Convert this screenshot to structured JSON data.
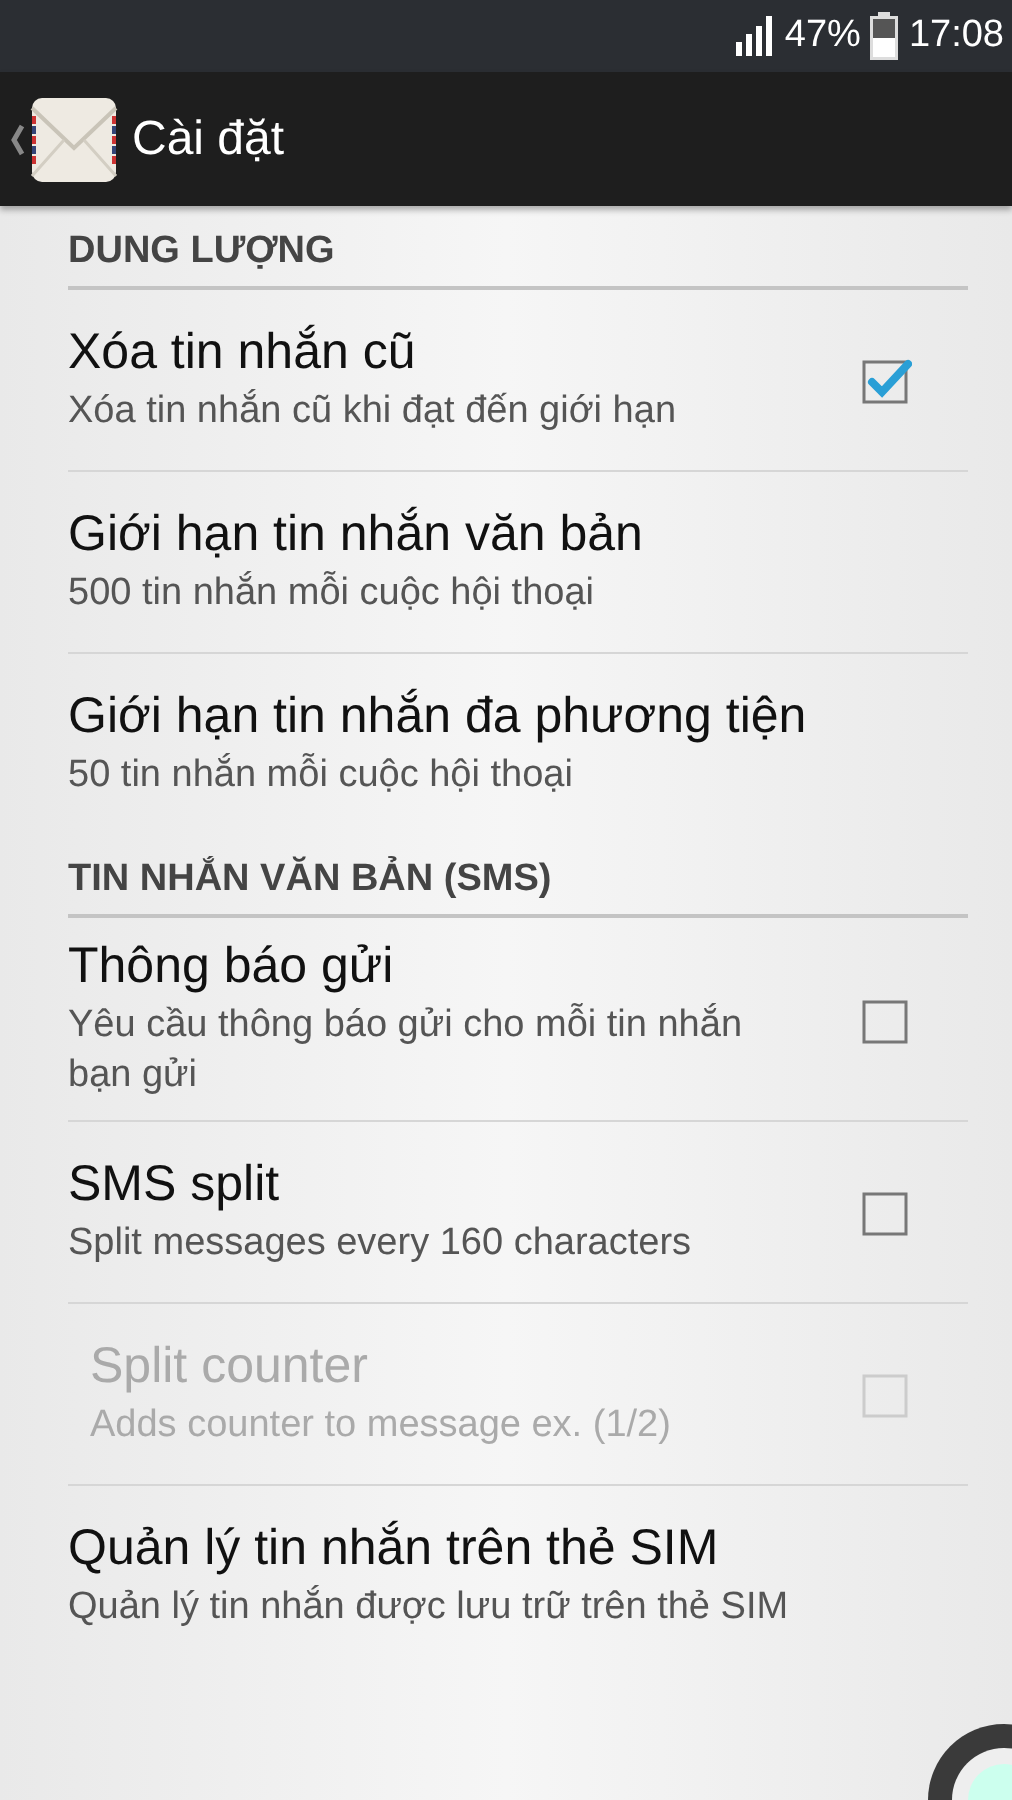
{
  "status_bar": {
    "battery": "47%",
    "time": "17:08"
  },
  "action_bar": {
    "title": "Cài đặt"
  },
  "sections": [
    {
      "header": "DUNG LƯỢNG",
      "items": [
        {
          "kind": "checkbox",
          "title": "Xóa tin nhắn cũ",
          "summary": "Xóa tin nhắn cũ khi đạt đến giới hạn",
          "checked": true,
          "disabled": false
        },
        {
          "kind": "plain",
          "title": "Giới hạn tin nhắn văn bản",
          "summary": "500 tin nhắn mỗi cuộc hội thoại",
          "disabled": false
        },
        {
          "kind": "plain",
          "title": "Giới hạn tin nhắn đa phương tiện",
          "summary": "50 tin nhắn mỗi cuộc hội thoại",
          "disabled": false
        }
      ]
    },
    {
      "header": "TIN NHẮN VĂN BẢN (SMS)",
      "items": [
        {
          "kind": "checkbox",
          "title": "Thông báo gửi",
          "summary": "Yêu cầu thông báo gửi cho mỗi tin nhắn bạn gửi",
          "checked": false,
          "disabled": false
        },
        {
          "kind": "checkbox",
          "title": "SMS split",
          "summary": "Split messages every 160 characters",
          "checked": false,
          "disabled": false
        },
        {
          "kind": "checkbox",
          "title": "Split counter",
          "summary": "Adds counter to message ex. (1/2)",
          "checked": false,
          "disabled": true
        },
        {
          "kind": "plain",
          "title": "Quản lý tin nhắn trên thẻ SIM",
          "summary": "Quản lý tin nhắn được lưu trữ trên thẻ SIM",
          "disabled": false
        }
      ]
    }
  ]
}
